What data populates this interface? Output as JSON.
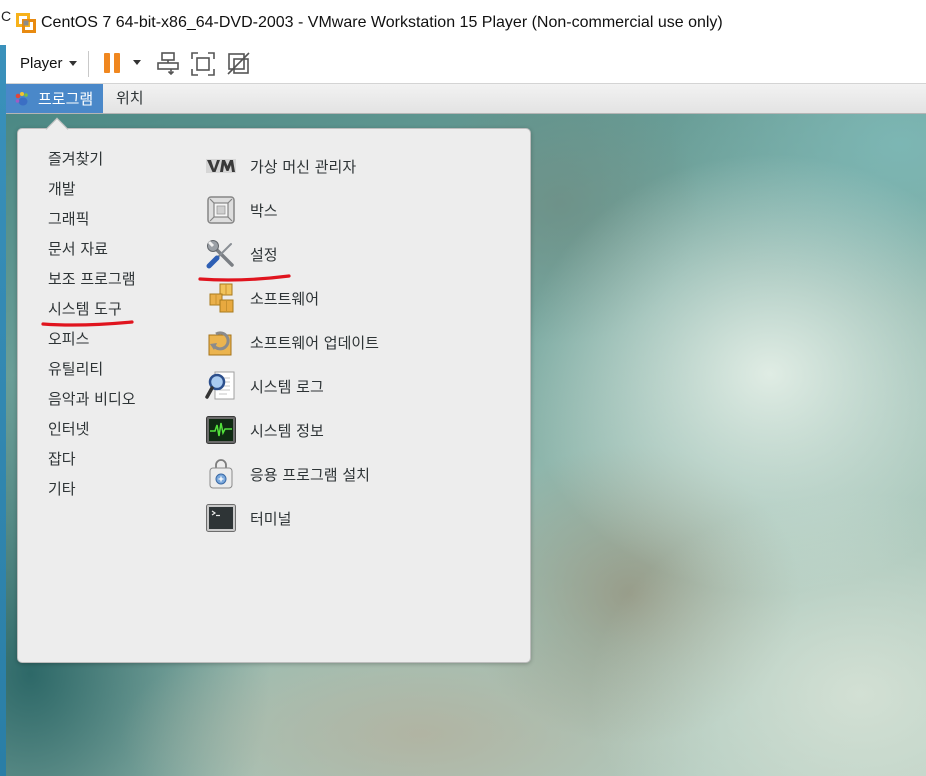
{
  "window": {
    "title": "CentOS 7 64-bit-x86_64-DVD-2003 - VMware Workstation 15 Player (Non-commercial use only)",
    "icon": "vmware-player-icon"
  },
  "host": {
    "edge_text": "C"
  },
  "toolbar": {
    "player_label": "Player",
    "icons": [
      "chevron-down-icon",
      "pause-icon",
      "dropdown-arrow-icon",
      "send-ctrl-alt-del-icon",
      "fullscreen-icon",
      "unity-icon"
    ]
  },
  "gnome_topbar": {
    "applications_label": "프로그램",
    "applications_icon": "gnome-foot-icon",
    "places_label": "위치"
  },
  "apps_menu": {
    "categories": [
      {
        "label": "즐겨찾기"
      },
      {
        "label": "개발"
      },
      {
        "label": "그래픽"
      },
      {
        "label": "문서 자료"
      },
      {
        "label": "보조 프로그램"
      },
      {
        "label": "시스템 도구"
      },
      {
        "label": "오피스"
      },
      {
        "label": "유틸리티"
      },
      {
        "label": "음악과 비디오"
      },
      {
        "label": "인터넷"
      },
      {
        "label": "잡다"
      },
      {
        "label": "기타"
      }
    ],
    "apps": [
      {
        "label": "가상 머신 관리자",
        "icon": "virt-manager-icon"
      },
      {
        "label": "박스",
        "icon": "boxes-icon"
      },
      {
        "label": "설정",
        "icon": "settings-tools-icon"
      },
      {
        "label": "소프트웨어",
        "icon": "software-packages-icon"
      },
      {
        "label": "소프트웨어 업데이트",
        "icon": "software-update-icon"
      },
      {
        "label": "시스템 로그",
        "icon": "system-log-icon"
      },
      {
        "label": "시스템 정보",
        "icon": "system-monitor-icon"
      },
      {
        "label": "응용 프로그램 설치",
        "icon": "app-install-icon"
      },
      {
        "label": "터미널",
        "icon": "terminal-icon"
      }
    ]
  },
  "colors": {
    "applications_highlight": "#4a88c9",
    "pause_icon": "#f0871f",
    "annotation_underline": "#e0141e",
    "menu_background": "#ededed",
    "menu_text": "#2e3436"
  }
}
